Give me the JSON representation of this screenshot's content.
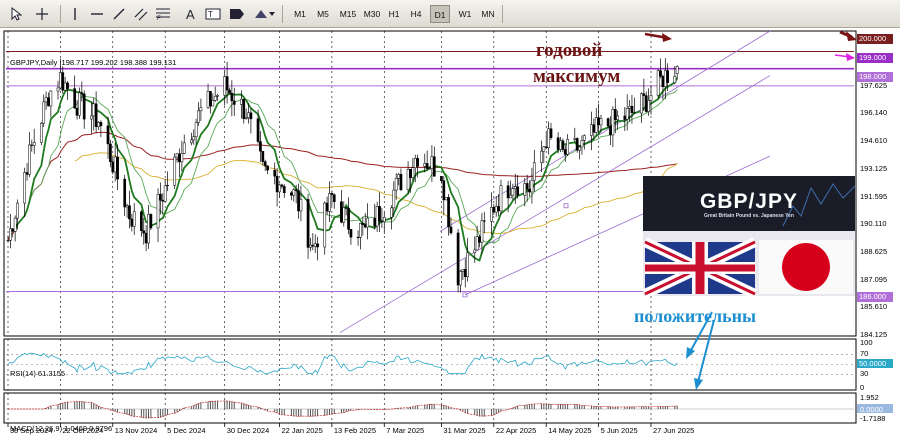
{
  "toolbar": {
    "timeframes": [
      "M1",
      "M5",
      "M15",
      "M30",
      "H1",
      "H4",
      "D1",
      "W1",
      "MN"
    ],
    "active_timeframe": "D1"
  },
  "chart": {
    "symbol_info": "GBPJPY,Daily  198.717 199.202 198.388 199.131",
    "rsi_label": "RSI(14) 61.3155",
    "macd_label": "MACD(12,26,9) 1.0469 0.9796"
  },
  "annotations": {
    "title_line1": "годовой",
    "title_line2": "максимум",
    "positive": "положительны"
  },
  "logo": {
    "title": "GBP/JPY",
    "subtitle": "Great Britain Pound vs. Japanese Yen"
  },
  "badges": [
    {
      "value": "200.000",
      "bg": "#7a1f1f",
      "color": "#ffffff"
    },
    {
      "value": "199.000",
      "bg": "#9a2fc8",
      "color": "#ffffff"
    },
    {
      "value": "198.000",
      "bg": "#b06fd8",
      "color": "#ffffff"
    },
    {
      "value": "186.000",
      "bg": "#b06fd8",
      "color": "#ffffff"
    }
  ],
  "price_axis": [
    "197.625",
    "196.140",
    "194.610",
    "193.125",
    "191.595",
    "190.110",
    "188.625",
    "187.095",
    "185.610",
    "184.125"
  ],
  "rsi_axis": [
    "100",
    "70",
    "50.0000",
    "30",
    "0"
  ],
  "macd_axis": [
    "1.952",
    "0.0000",
    "-1.7188"
  ],
  "time_axis": [
    "30 Sep 2024",
    "22 Oct 2024",
    "13 Nov 2024",
    "5 Dec 2024",
    "30 Dec 2024",
    "22 Jan 2025",
    "13 Feb 2025",
    "7 Mar 2025",
    "31 Mar 2025",
    "22 Apr 2025",
    "14 May 2025",
    "5 Jun 2025",
    "27 Jun 2025"
  ],
  "colors": {
    "accent_arrow_dark": "#7a1414",
    "accent_arrow_pink": "#e020e0",
    "accent_blue": "#1c8fd0",
    "ma_green": "#1f7a1f",
    "ma_red": "#9c2020",
    "ma_yellow": "#d8b030",
    "rsi_line": "#2aa8c8"
  },
  "chart_data": {
    "type": "candlestick",
    "pair": "GBPJPY",
    "timeframe": "Daily",
    "last_bar": {
      "open": 198.717,
      "high": 199.202,
      "low": 198.388,
      "close": 199.131
    },
    "ylim": [
      183.4,
      201.2
    ],
    "trend": [
      [
        "30 Sep 2024",
        189.0
      ],
      [
        "8 Oct 2024",
        193.5
      ],
      [
        "17 Oct 2024",
        197.5
      ],
      [
        "22 Oct 2024",
        198.5
      ],
      [
        "29 Oct 2024",
        197.0
      ],
      [
        "7 Nov 2024",
        196.0
      ],
      [
        "13 Nov 2024",
        193.5
      ],
      [
        "20 Nov 2024",
        190.5
      ],
      [
        "27 Nov 2024",
        189.5
      ],
      [
        "5 Dec 2024",
        192.0
      ],
      [
        "12 Dec 2024",
        194.5
      ],
      [
        "20 Dec 2024",
        196.5
      ],
      [
        "30 Dec 2024",
        198.0
      ],
      [
        "8 Jan 2025",
        196.5
      ],
      [
        "15 Jan 2025",
        193.0
      ],
      [
        "22 Jan 2025",
        192.5
      ],
      [
        "29 Jan 2025",
        191.5
      ],
      [
        "5 Feb 2025",
        188.5
      ],
      [
        "13 Feb 2025",
        191.5
      ],
      [
        "20 Feb 2025",
        190.0
      ],
      [
        "27 Feb 2025",
        189.5
      ],
      [
        "7 Mar 2025",
        191.0
      ],
      [
        "14 Mar 2025",
        192.5
      ],
      [
        "21 Mar 2025",
        194.0
      ],
      [
        "31 Mar 2025",
        193.0
      ],
      [
        "7 Apr 2025",
        187.0
      ],
      [
        "14 Apr 2025",
        188.5
      ],
      [
        "22 Apr 2025",
        191.0
      ],
      [
        "30 Apr 2025",
        192.5
      ],
      [
        "7 May 2025",
        192.0
      ],
      [
        "14 May 2025",
        195.0
      ],
      [
        "21 May 2025",
        194.0
      ],
      [
        "29 May 2025",
        194.5
      ],
      [
        "5 Jun 2025",
        195.5
      ],
      [
        "13 Jun 2025",
        196.0
      ],
      [
        "20 Jun 2025",
        196.5
      ],
      [
        "27 Jun 2025",
        197.5
      ],
      [
        "2 Jul 2025",
        198.5
      ],
      [
        "8 Jul 2025",
        199.131
      ]
    ],
    "levels": [
      200.0,
      199.0,
      198.0,
      186.0
    ]
  }
}
